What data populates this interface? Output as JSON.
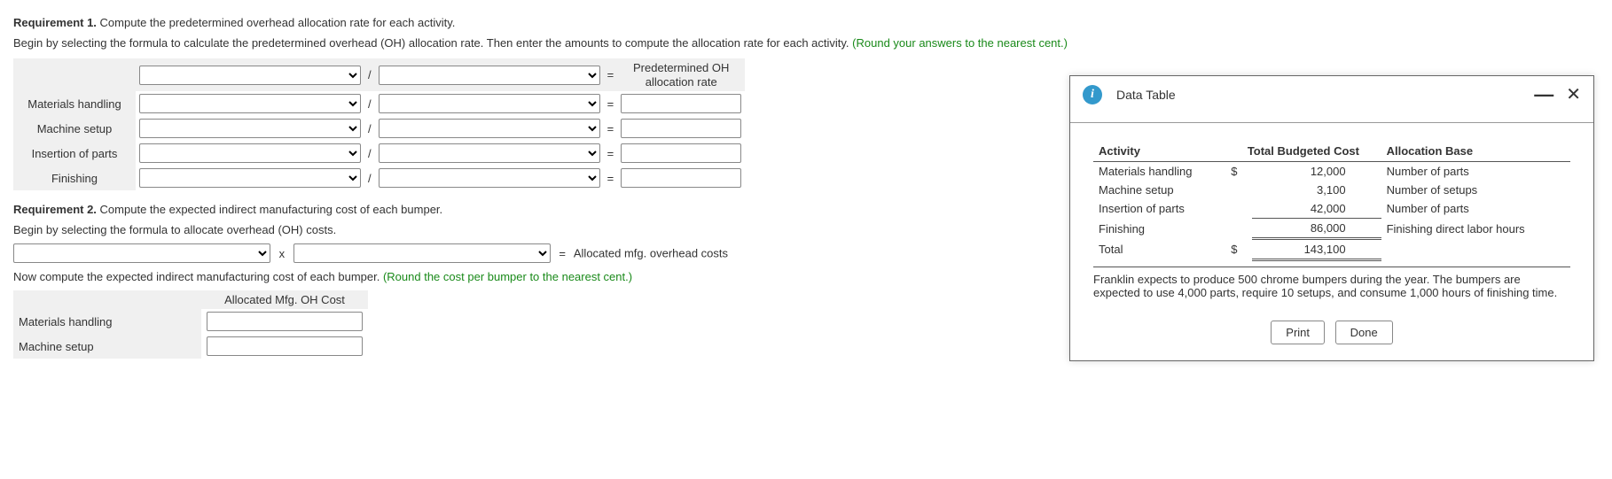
{
  "req1": {
    "label": "Requirement 1.",
    "text": "Compute the predetermined overhead allocation rate for each activity.",
    "instruction_a": "Begin by selecting the formula to calculate the predetermined overhead (OH) allocation rate. Then enter the amounts to compute the allocation rate for each activity.",
    "round_hint": "(Round your answers to the nearest cent.)",
    "header_result_top": "Predetermined OH",
    "header_result_bot": "allocation rate",
    "rows": [
      "Materials handling",
      "Machine setup",
      "Insertion of parts",
      "Finishing"
    ],
    "divide": "/",
    "equals": "="
  },
  "req2": {
    "label": "Requirement 2.",
    "text": "Compute the expected indirect manufacturing cost of each bumper.",
    "instruction_a": "Begin by selecting the formula to allocate overhead (OH) costs.",
    "times": "x",
    "equals": "=",
    "result_label": "Allocated mfg. overhead costs",
    "instruction_b": "Now compute the expected indirect manufacturing cost of each bumper.",
    "round_hint": "(Round the cost per bumper to the nearest cent.)",
    "table_header": "Allocated Mfg. OH Cost",
    "rows": [
      "Materials handling",
      "Machine setup"
    ]
  },
  "popup": {
    "title": "Data Table",
    "headers": [
      "Activity",
      "Total Budgeted Cost",
      "Allocation Base"
    ],
    "currency": "$",
    "rows": [
      {
        "activity": "Materials handling",
        "cost": "12,000",
        "base": "Number of parts"
      },
      {
        "activity": "Machine setup",
        "cost": "3,100",
        "base": "Number of setups"
      },
      {
        "activity": "Insertion of parts",
        "cost": "42,000",
        "base": "Number of parts"
      },
      {
        "activity": "Finishing",
        "cost": "86,000",
        "base": "Finishing direct labor hours"
      }
    ],
    "total_label": "Total",
    "total_value": "143,100",
    "footnote": "Franklin expects to produce 500 chrome bumpers during the year. The bumpers are expected to use 4,000 parts, require 10 setups, and consume 1,000 hours of finishing time.",
    "print": "Print",
    "done": "Done"
  },
  "chart_data": {
    "type": "table",
    "title": "Data Table — Total Budgeted Cost by Activity",
    "columns": [
      "Activity",
      "Total Budgeted Cost ($)",
      "Allocation Base"
    ],
    "rows": [
      [
        "Materials handling",
        12000,
        "Number of parts"
      ],
      [
        "Machine setup",
        3100,
        "Number of setups"
      ],
      [
        "Insertion of parts",
        42000,
        "Number of parts"
      ],
      [
        "Finishing",
        86000,
        "Finishing direct labor hours"
      ]
    ],
    "total": 143100,
    "production_info": {
      "chrome_bumpers": 500,
      "parts": 4000,
      "setups": 10,
      "finishing_hours": 1000
    }
  }
}
